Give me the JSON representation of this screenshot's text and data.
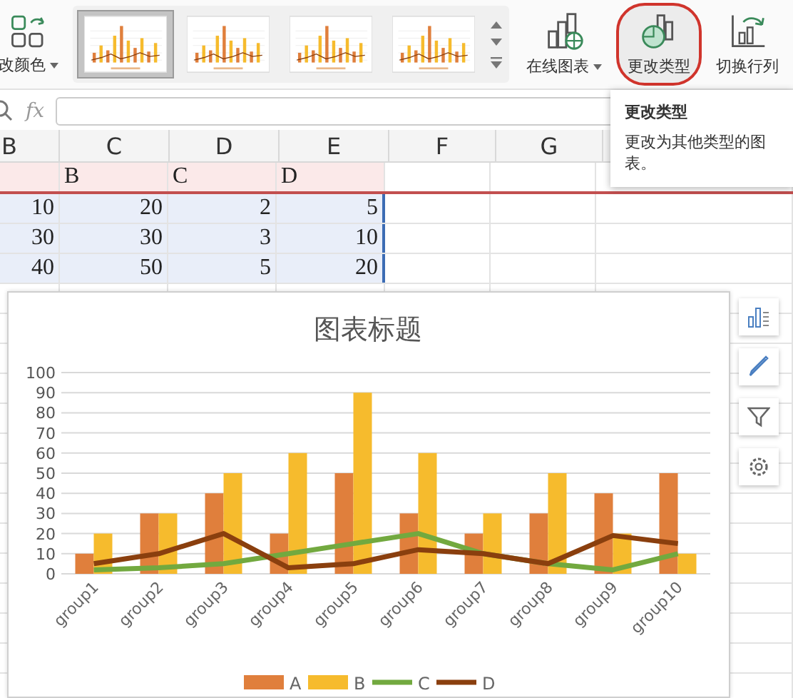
{
  "ribbon": {
    "color_button": {
      "label": "改颜色",
      "dropdown": true
    },
    "style_gallery": [
      {
        "selected": true
      },
      {
        "selected": false
      },
      {
        "selected": false
      },
      {
        "selected": false
      }
    ],
    "buttons": [
      {
        "kind": "online",
        "label": "在线图表",
        "dropdown": true,
        "highlighted": false
      },
      {
        "kind": "change",
        "label": "更改类型",
        "highlighted": true
      },
      {
        "kind": "switch",
        "label": "切换行列",
        "highlighted": false
      }
    ]
  },
  "formula_bar": {
    "fx_label": "fx"
  },
  "sheet": {
    "columns": [
      "B",
      "C",
      "D",
      "E",
      "F",
      "G"
    ],
    "rows": [
      {
        "kind": "header",
        "cells": [
          "",
          "B",
          "C",
          "D"
        ]
      },
      {
        "kind": "data",
        "cells": [
          "10",
          "20",
          "2",
          "5"
        ]
      },
      {
        "kind": "data",
        "cells": [
          "30",
          "30",
          "3",
          "10"
        ]
      },
      {
        "kind": "data",
        "cells": [
          "40",
          "50",
          "5",
          "20"
        ]
      }
    ]
  },
  "tooltip": {
    "title": "更改类型",
    "text": "更改为其他类型的图表。"
  },
  "chart": {
    "chart_data": {
      "type": "bar",
      "title": "图表标题",
      "categories": [
        "group1",
        "group2",
        "group3",
        "group4",
        "group5",
        "group6",
        "group7",
        "group8",
        "group9",
        "group10"
      ],
      "stacked": false,
      "grid": true,
      "legend": true,
      "ylim": [
        0,
        100
      ],
      "yticks": [
        0,
        10,
        20,
        30,
        40,
        50,
        60,
        70,
        80,
        90,
        100
      ],
      "series": [
        {
          "name": "A",
          "type": "bar",
          "color": "#e07f3c",
          "values": [
            10,
            30,
            40,
            20,
            50,
            30,
            20,
            30,
            40,
            50
          ]
        },
        {
          "name": "B",
          "type": "bar",
          "color": "#f6bb2d",
          "values": [
            20,
            30,
            50,
            60,
            90,
            60,
            30,
            50,
            20,
            10
          ]
        },
        {
          "name": "C",
          "type": "line",
          "color": "#72a93f",
          "values": [
            2,
            3,
            5,
            10,
            15,
            20,
            10,
            5,
            2,
            10
          ]
        },
        {
          "name": "D",
          "type": "line",
          "color": "#8a3f0e",
          "values": [
            5,
            10,
            20,
            3,
            5,
            12,
            10,
            5,
            19,
            15
          ]
        }
      ]
    }
  }
}
